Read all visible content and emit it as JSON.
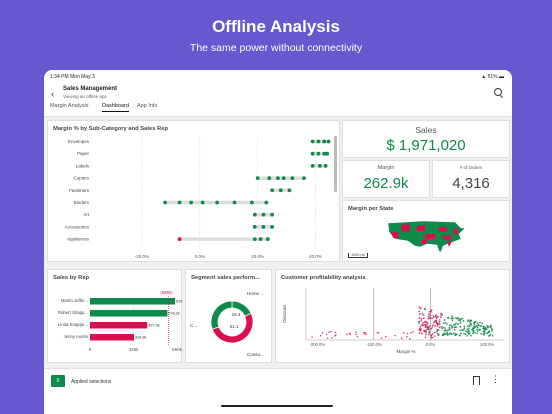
{
  "hero": {
    "title": "Offline Analysis",
    "subtitle": "The same power without connectivity"
  },
  "status": {
    "time": "1:34 PM  Mon May 3",
    "battery": "51%"
  },
  "app": {
    "title": "Sales Management",
    "subtitle": "Viewing an offline app"
  },
  "tabs": [
    {
      "label": "Margin Analysis"
    },
    {
      "label": "Dashboard"
    },
    {
      "label": "App Info"
    }
  ],
  "panels": {
    "margin_title": "Margin % by Sub-Category and Sales Rep",
    "sales_label": "Sales",
    "sales_value": "$ 1,971,020",
    "margin_label": "Margin",
    "margin_value": "262.9k",
    "orders_label": "# of Orders",
    "orders_value": "4,316",
    "map_title": "Margin per State",
    "map_scale": "1000 mi",
    "rep_title": "Sales by Rep",
    "segment_title": "Segment sales perform...",
    "profit_title": "Customer profitability analysis"
  },
  "colors": {
    "green": "#0e8a4a",
    "red": "#d90f4e",
    "purple": "#6658cf"
  },
  "bottom": {
    "badge": "0",
    "label": "Applied selections"
  },
  "chart_data": [
    {
      "type": "scatter",
      "title": "Margin % by Sub-Category and Sales Rep",
      "categories": [
        "Envelopes",
        "Paper",
        "Labels",
        "Copiers",
        "Fasteners",
        "Binders",
        "Art",
        "Accessories",
        "Appliances"
      ],
      "x_ticks": [
        "-20.0%",
        "0.0%",
        "20.0%",
        "40.0%"
      ],
      "xlim": [
        -30,
        45
      ],
      "points": [
        {
          "c": 0,
          "x": [
            39,
            41,
            43,
            44.5
          ]
        },
        {
          "c": 1,
          "x": [
            39,
            41,
            43,
            44
          ]
        },
        {
          "c": 2,
          "x": [
            39,
            41.5,
            43.5
          ]
        },
        {
          "c": 3,
          "x": [
            20,
            24,
            27,
            29,
            32,
            36
          ]
        },
        {
          "c": 4,
          "x": [
            25,
            28,
            31
          ]
        },
        {
          "c": 5,
          "x": [
            -12,
            -7,
            -3,
            1,
            6,
            12,
            18,
            23
          ]
        },
        {
          "c": 6,
          "x": [
            19,
            22,
            25
          ]
        },
        {
          "c": 7,
          "x": [
            19,
            22,
            25
          ]
        },
        {
          "c": 8,
          "x": [
            -7,
            19,
            21,
            23.5
          ]
        }
      ],
      "red_points": [
        {
          "c": 8,
          "x": -7
        }
      ]
    },
    {
      "type": "bar",
      "title": "Sales by Rep",
      "categories": [
        "Martin Jeffer...",
        "Robert Shapp...",
        "Linda Knappe...",
        "Jenny Austin"
      ],
      "values": [
        635.4,
        578.2,
        427.5,
        328.8
      ],
      "value_labels": [
        "635.4k",
        "578.2k",
        "427.5k",
        "328.8k"
      ],
      "annotation": "(586k)",
      "x_ticks": [
        "0",
        "325k",
        "650k"
      ],
      "xlim": [
        0,
        650
      ]
    },
    {
      "type": "pie",
      "title": "Segment sales perform...",
      "slices": [
        {
          "name": "Home ...",
          "value": 18.3
        },
        {
          "name": "Consu...",
          "value": 51.1
        },
        {
          "name": "C...",
          "value": 30.6
        }
      ],
      "value_labels": [
        "18.3",
        "51.1"
      ]
    },
    {
      "type": "scatter",
      "title": "Customer profitability analysis",
      "xlabel": "Margin %",
      "ylabel": "Discount",
      "x_ticks": [
        "-200.0%",
        "-100.0%",
        "0.0%",
        "100.0%"
      ],
      "xlim": [
        -220,
        130
      ],
      "ylim": [
        0,
        1
      ]
    }
  ]
}
